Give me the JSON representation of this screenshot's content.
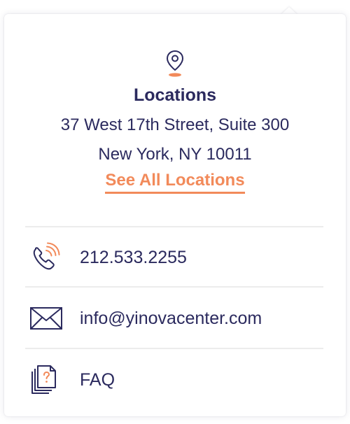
{
  "locations": {
    "title": "Locations",
    "address_line1": "37 West 17th Street, Suite 300",
    "address_line2": "New York, NY 10011",
    "link_label": "See All Locations"
  },
  "contacts": [
    {
      "label": "212.533.2255",
      "icon": "phone-icon"
    },
    {
      "label": "info@yinovacenter.com",
      "icon": "mail-icon"
    },
    {
      "label": "FAQ",
      "icon": "faq-documents-icon"
    }
  ],
  "colors": {
    "navy": "#2b2a5e",
    "accent": "#f28a5a",
    "divider": "#ececec"
  }
}
